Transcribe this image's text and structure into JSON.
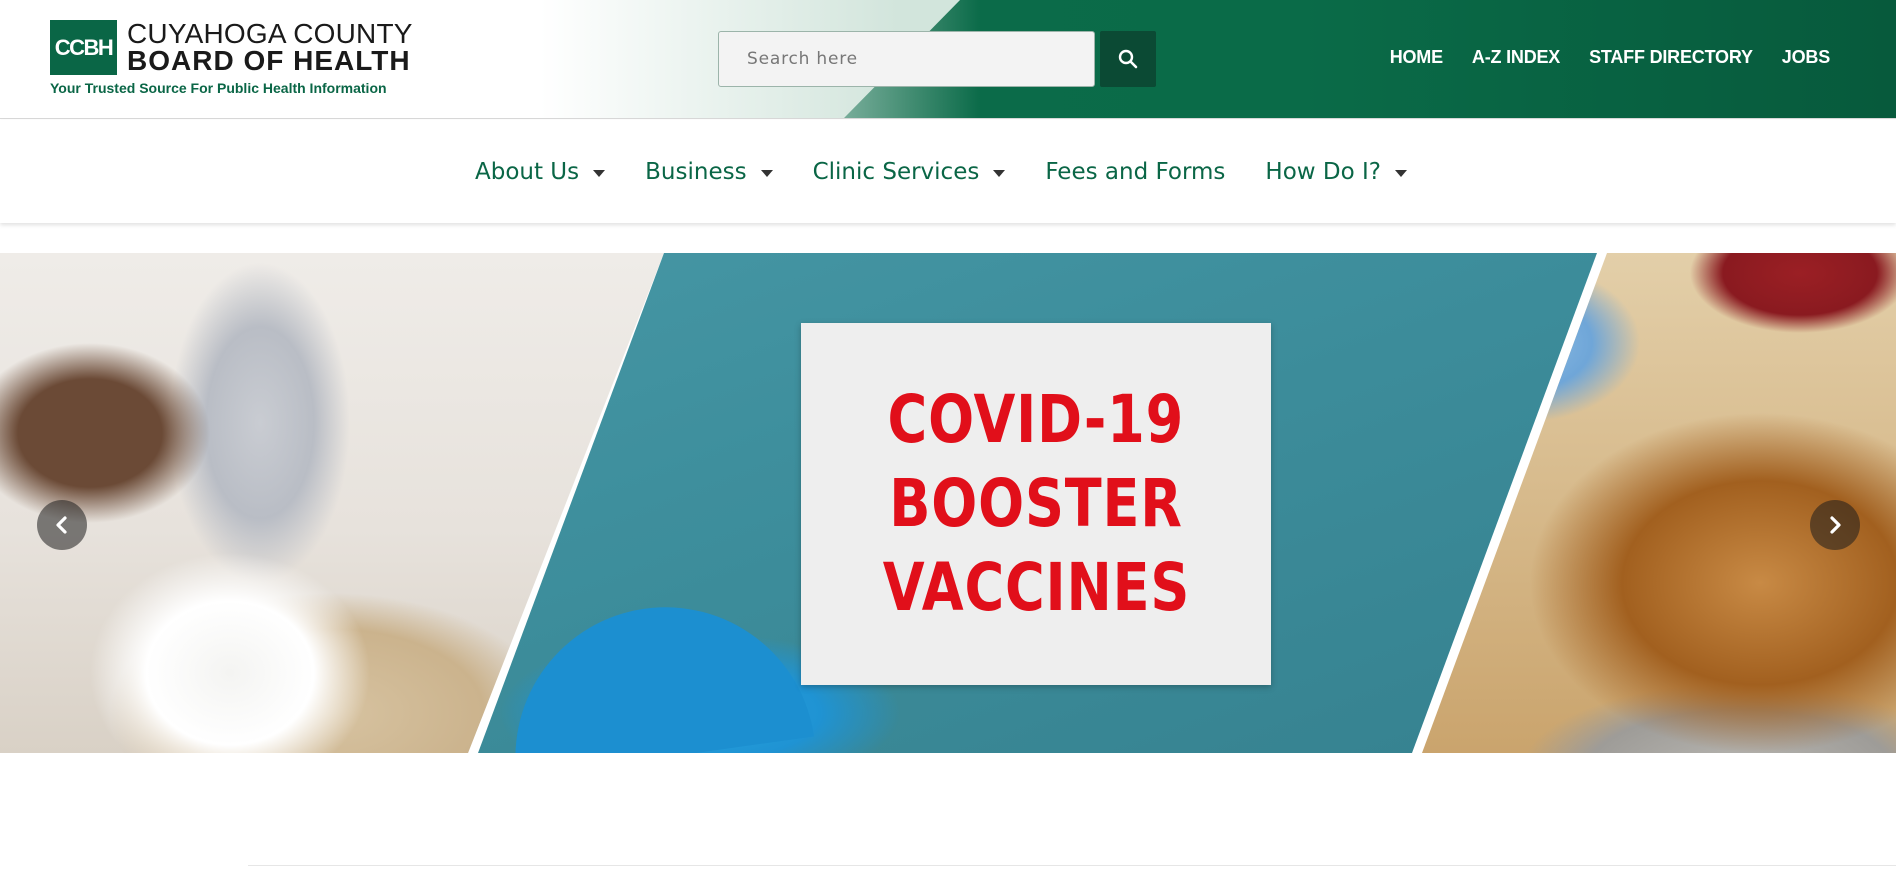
{
  "header": {
    "logo": {
      "mark": "CCBH",
      "line1": "CUYAHOGA COUNTY",
      "line2": "BOARD OF HEALTH",
      "tagline": "Your Trusted Source For Public Health Information"
    },
    "search": {
      "placeholder": "Search here",
      "button_icon": "search-icon"
    },
    "utility_nav": [
      "HOME",
      "A-Z INDEX",
      "STAFF DIRECTORY",
      "JOBS"
    ],
    "colors": {
      "brand_green": "#0a6646",
      "dark_green": "#0b4a34"
    }
  },
  "main_nav": [
    {
      "label": "About Us",
      "has_dropdown": true
    },
    {
      "label": "Business",
      "has_dropdown": true
    },
    {
      "label": "Clinic Services",
      "has_dropdown": true
    },
    {
      "label": "Fees and Forms",
      "has_dropdown": false
    },
    {
      "label": "How Do I?",
      "has_dropdown": true
    }
  ],
  "hero": {
    "slide_text": [
      "COVID-19",
      "BOOSTER",
      "VACCINES"
    ],
    "slide_text_color": "#e10f1a",
    "prev_icon": "chevron-left-icon",
    "next_icon": "chevron-right-icon"
  }
}
